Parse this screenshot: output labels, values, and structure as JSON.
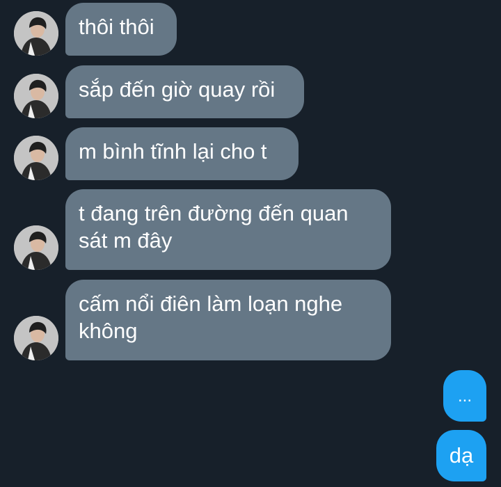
{
  "conversation": {
    "incoming": [
      {
        "text": "thôi thôi"
      },
      {
        "text": "sắp đến giờ quay rồi"
      },
      {
        "text": "m bình tĩnh lại cho t"
      },
      {
        "text": "t đang trên đường đến quan sát m đây"
      },
      {
        "text": "cấm nổi điên làm loạn nghe không"
      }
    ],
    "outgoing": [
      {
        "text": "..."
      },
      {
        "text": "dạ"
      }
    ]
  },
  "colors": {
    "background": "#17202a",
    "incoming_bubble": "#657786",
    "outgoing_bubble": "#1da1f2",
    "text": "#ffffff"
  },
  "icons": {
    "avatar": "sender-avatar"
  }
}
